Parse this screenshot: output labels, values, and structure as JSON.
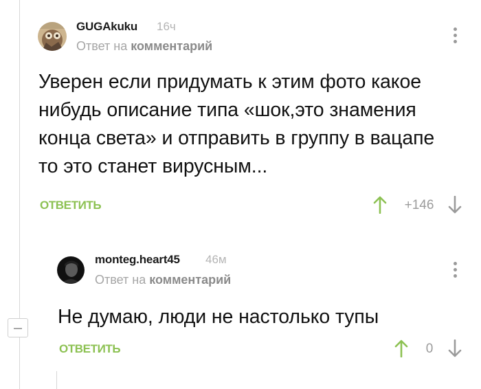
{
  "comments": [
    {
      "author": "GUGAkuku",
      "time": "16ч",
      "reply_prefix": "Ответ на",
      "reply_link": "комментарий",
      "text_lines": [
        "Уверен если придумать к этим фото какое",
        "нибудь описание типа «шок,это знамения",
        "конца света» и отправить в группу в вацапе",
        "то это станет вирусным..."
      ],
      "reply_label": "ОТВЕТИТЬ",
      "rating": "+146"
    },
    {
      "author": "monteg.heart45",
      "time": "46м",
      "reply_prefix": "Ответ на",
      "reply_link": "комментарий",
      "text_lines": [
        "Не думаю, люди не настолько тупы"
      ],
      "reply_label": "ОТВЕТИТЬ",
      "rating": "0"
    }
  ],
  "colors": {
    "accent_green": "#8cc152",
    "muted_gray": "#a5a5a5"
  },
  "icons": {
    "upvote": "arrow-up-icon",
    "downvote": "arrow-down-icon",
    "more": "vertical-dots-icon",
    "collapse": "minus-icon"
  }
}
